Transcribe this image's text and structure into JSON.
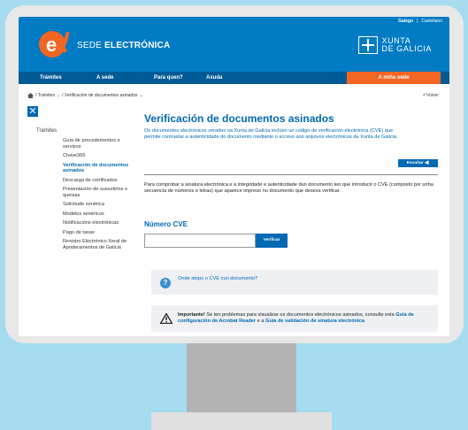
{
  "header": {
    "lang_gl": "Galego",
    "lang_sep": "|",
    "lang_es": "Castellano",
    "brand_prefix": "SEDE",
    "brand_main": "ELECTRÓNICA",
    "xunta_line1": "XUNTA",
    "xunta_line2": "DE GALICIA"
  },
  "nav": {
    "items": [
      "Trámites",
      "A sede",
      "Para quen?",
      "Axuda"
    ],
    "mina_sede": "A miña sede"
  },
  "breadcrumb": {
    "level1": "/ Trámites",
    "level2": "/ Verificación de documentos asinados",
    "back": "Volver"
  },
  "sidebar": {
    "close": "✕",
    "title": "Trámites",
    "items": [
      "Guía de procedementos e servizos",
      "Chave365",
      "Verificación de documentos asinados",
      "Descarga de certificados",
      "Presentación de suxestións e queixas",
      "Solicitude xenérica",
      "Modelos xenéricos",
      "Notificacións electrónicas",
      "Pago de taxas",
      "Rexistro Electrónico Xeral de Apoderamentos de Galicia"
    ]
  },
  "main": {
    "title": "Verificación de documentos asinados",
    "intro": "Os documentos electrónicos xerados na Xunta de Galicia inclúen un código de verificación electrónica (CVE) que permite contrastar a autenticidade do documento mediante o acceso aos arquivos electrónicos da Xunta de Galicia.",
    "escoitar": "Escoitar",
    "para": "Para comprobar a sinatura electrónica e a integridade e autenticidade dun documento ten que introducir o CVE (composto por unha secuencia de números e letras) que aparece impreso no documento que desexa verificar.",
    "cve_label": "Número CVE",
    "cve_value": "",
    "verificar": "Verificar",
    "help_link": "Onde atopo o CVE nun documento?",
    "warn_bold": "Importante!",
    "warn_text1": " Se ten problemas para visualizar os documentos electrónicos asinados, consulte esta ",
    "warn_link1": "Guía de configuración de Acrobat Reader",
    "warn_text2": " e a ",
    "warn_link2": "Guía de validación de sinatura electrónica",
    "warn_text3": "."
  },
  "colors": {
    "primary": "#007bc4",
    "nav": "#005b96",
    "accent": "#f26522",
    "background": "#a6dcef"
  }
}
